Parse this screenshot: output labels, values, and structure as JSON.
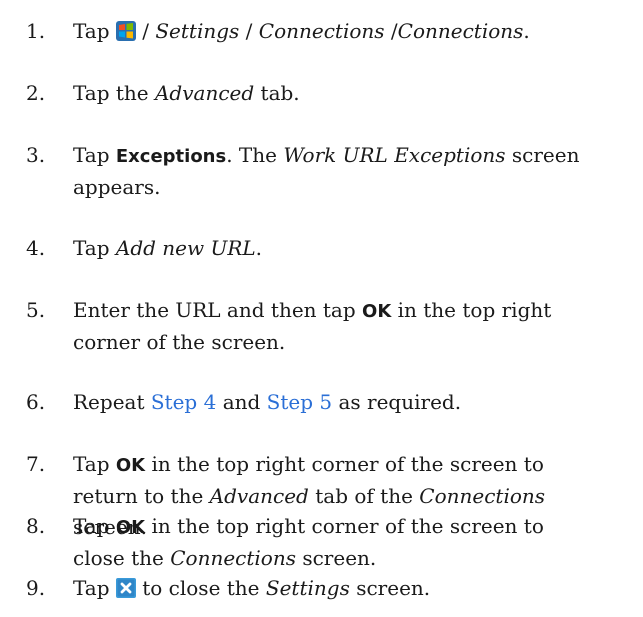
{
  "steps": [
    {
      "num": "1.",
      "tap": "Tap",
      "sep1": "/",
      "settings": "Settings",
      "sep2": "/",
      "connections1": "Connections",
      "sep3": "/",
      "connections2": "Connections",
      "end": ".",
      "icon": "windows-start-icon"
    },
    {
      "num": "2.",
      "pre": "Tap the",
      "em": "Advanced",
      "post": "tab."
    },
    {
      "num": "3.",
      "pre": "Tap",
      "ui": "Exceptions",
      "mid": ". The",
      "em": "Work URL Exceptions",
      "post": "screen",
      "line2": "appears."
    },
    {
      "num": "4.",
      "pre": "Tap",
      "em": "Add new URL",
      "post": "."
    },
    {
      "num": "5.",
      "pre": "Enter the URL and then tap",
      "ui": "OK",
      "post": "in the top right",
      "line2": "corner of the screen."
    },
    {
      "num": "6.",
      "pre": "Repeat",
      "link1": "Step 4",
      "mid": "and",
      "link2": "Step 5",
      "post": "as required."
    },
    {
      "num": "7.",
      "pre": "Tap",
      "ui": "OK",
      "post": "in the top right corner of the screen to",
      "line2a": "return to the",
      "em1": "Advanced",
      "line2b": "tab of the",
      "em2": "Connections",
      "line3": "screen."
    },
    {
      "num": "8.",
      "pre": "Tap",
      "ui": "OK",
      "post": "in the top right corner of the screen to",
      "line2a": "close the",
      "em": "Connections",
      "line2b": "screen."
    },
    {
      "num": "9.",
      "pre": "Tap",
      "post": "to close the",
      "em": "Settings",
      "end": "screen.",
      "icon": "close-x-icon"
    }
  ],
  "colors": {
    "link": "#2b6fd6",
    "icon_close_bg": "#3a9ad9"
  }
}
